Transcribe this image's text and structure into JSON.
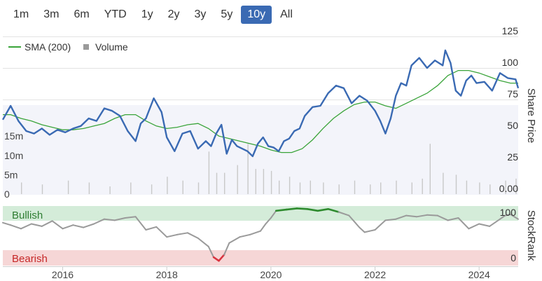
{
  "range_selector": {
    "buttons": [
      "1m",
      "3m",
      "6m",
      "YTD",
      "1y",
      "2y",
      "3y",
      "5y",
      "10y",
      "All"
    ],
    "active": "10y"
  },
  "colors": {
    "price": "#3a6ab3",
    "sma": "#3aa43a",
    "volume": "#c8c8c8",
    "bullish_band": "#d4ecd9",
    "bearish_band": "#f6d6d6",
    "stockrank_neutral": "#9a9a9a",
    "stockrank_bullish": "#2e8b2e",
    "stockrank_bearish": "#d9333f"
  },
  "chart_data": {
    "type": "line",
    "legend": [
      {
        "name": "SMA (200)",
        "marker": "line"
      },
      {
        "name": "Volume",
        "marker": "square"
      }
    ],
    "x_axis": {
      "ticks": [
        "2016",
        "2018",
        "2020",
        "2022",
        "2024"
      ],
      "xlim": [
        2014.85,
        2024.75
      ]
    },
    "price_axis": {
      "label": "Share Price",
      "ticks": [
        "125",
        "100",
        "75",
        "50",
        "25",
        "0.00"
      ],
      "ylim": [
        0,
        125
      ]
    },
    "volume_axis": {
      "ticks": [
        "15m",
        "10m",
        "5m",
        "0"
      ],
      "ylim": [
        0,
        23000000
      ]
    },
    "stockrank_axis": {
      "label": "StockRank",
      "ticks": [
        "100",
        "0"
      ],
      "ylim": [
        0,
        100
      ]
    },
    "bands": {
      "bullish": "Bullish",
      "bearish": "Bearish"
    },
    "price": {
      "x": [
        2014.85,
        2015.0,
        2015.15,
        2015.3,
        2015.45,
        2015.6,
        2015.75,
        2015.9,
        2016.05,
        2016.2,
        2016.35,
        2016.5,
        2016.65,
        2016.8,
        2016.95,
        2017.1,
        2017.25,
        2017.4,
        2017.5,
        2017.6,
        2017.75,
        2017.9,
        2018.0,
        2018.15,
        2018.3,
        2018.45,
        2018.6,
        2018.75,
        2018.85,
        2018.95,
        2019.05,
        2019.15,
        2019.25,
        2019.35,
        2019.45,
        2019.55,
        2019.65,
        2019.75,
        2019.85,
        2019.95,
        2020.05,
        2020.15,
        2020.25,
        2020.35,
        2020.45,
        2020.55,
        2020.65,
        2020.8,
        2020.95,
        2021.1,
        2021.25,
        2021.4,
        2021.55,
        2021.7,
        2021.85,
        2022.0,
        2022.1,
        2022.2,
        2022.3,
        2022.4,
        2022.5,
        2022.6,
        2022.7,
        2022.85,
        2023.0,
        2023.15,
        2023.3,
        2023.35,
        2023.45,
        2023.55,
        2023.65,
        2023.75,
        2023.85,
        2023.95,
        2024.1,
        2024.25,
        2024.4,
        2024.55,
        2024.7,
        2024.75
      ],
      "values": [
        59,
        70,
        58,
        50,
        48,
        52,
        47,
        51,
        49,
        52,
        54,
        60,
        58,
        68,
        66,
        62,
        50,
        42,
        56,
        60,
        76,
        65,
        45,
        34,
        48,
        50,
        36,
        42,
        38,
        48,
        55,
        32,
        43,
        38,
        36,
        34,
        30,
        40,
        45,
        38,
        37,
        34,
        42,
        44,
        50,
        52,
        62,
        69,
        70,
        80,
        86,
        84,
        72,
        78,
        74,
        66,
        58,
        48,
        60,
        78,
        88,
        86,
        102,
        108,
        100,
        106,
        102,
        114,
        104,
        82,
        78,
        90,
        94,
        88,
        89,
        82,
        96,
        92,
        91,
        84
      ]
    },
    "sma_200": {
      "x": [
        2014.85,
        2015.0,
        2015.2,
        2015.4,
        2015.6,
        2015.8,
        2016.0,
        2016.2,
        2016.4,
        2016.6,
        2016.8,
        2017.0,
        2017.2,
        2017.4,
        2017.6,
        2017.8,
        2018.0,
        2018.2,
        2018.4,
        2018.6,
        2018.8,
        2019.0,
        2019.2,
        2019.4,
        2019.6,
        2019.8,
        2020.0,
        2020.2,
        2020.4,
        2020.6,
        2020.8,
        2021.0,
        2021.2,
        2021.4,
        2021.6,
        2021.8,
        2022.0,
        2022.2,
        2022.4,
        2022.6,
        2022.8,
        2023.0,
        2023.2,
        2023.4,
        2023.6,
        2023.8,
        2024.0,
        2024.2,
        2024.4,
        2024.6,
        2024.75
      ],
      "values": [
        63,
        63,
        60,
        58,
        55,
        53,
        51,
        51,
        52,
        54,
        56,
        60,
        63,
        63,
        58,
        54,
        52,
        53,
        55,
        56,
        52,
        46,
        44,
        42,
        40,
        38,
        35,
        33,
        33,
        36,
        43,
        52,
        60,
        66,
        71,
        73,
        73,
        70,
        68,
        72,
        76,
        80,
        86,
        94,
        98,
        98,
        96,
        93,
        90,
        88,
        88
      ]
    },
    "volume": {
      "x": [
        2015.2,
        2015.6,
        2016.1,
        2016.5,
        2016.9,
        2017.3,
        2017.7,
        2018.0,
        2018.3,
        2018.6,
        2018.8,
        2018.95,
        2019.1,
        2019.35,
        2019.55,
        2019.7,
        2019.85,
        2020.0,
        2020.15,
        2020.35,
        2020.55,
        2020.75,
        2021.0,
        2021.3,
        2021.6,
        2021.9,
        2022.1,
        2022.4,
        2022.7,
        2022.9,
        2023.05,
        2023.3,
        2023.55,
        2023.75,
        2024.0,
        2024.2,
        2024.5,
        2024.7
      ],
      "values": [
        3000000,
        2500000,
        3500000,
        3000000,
        2000000,
        3000000,
        2500000,
        4500000,
        3500000,
        3000000,
        11000000,
        5500000,
        5500000,
        7500000,
        13000000,
        6500000,
        6500000,
        6000000,
        3500000,
        4500000,
        3000000,
        3500000,
        3000000,
        2500000,
        3500000,
        2500000,
        3000000,
        3500000,
        3000000,
        4000000,
        13000000,
        5500000,
        5000000,
        3500000,
        3000000,
        2500000,
        3500000,
        4000000
      ]
    },
    "stockrank": {
      "x": [
        2014.85,
        2015.0,
        2015.2,
        2015.4,
        2015.6,
        2015.8,
        2016.0,
        2016.2,
        2016.4,
        2016.6,
        2016.8,
        2017.0,
        2017.2,
        2017.4,
        2017.6,
        2017.8,
        2018.0,
        2018.2,
        2018.4,
        2018.6,
        2018.8,
        2018.9,
        2019.0,
        2019.1,
        2019.2,
        2019.4,
        2019.6,
        2019.8,
        2019.9,
        2020.0,
        2020.1,
        2020.3,
        2020.5,
        2020.7,
        2020.9,
        2021.1,
        2021.3,
        2021.5,
        2021.7,
        2021.8,
        2021.9,
        2022.0,
        2022.2,
        2022.4,
        2022.6,
        2022.8,
        2023.0,
        2023.2,
        2023.4,
        2023.6,
        2023.8,
        2024.0,
        2024.2,
        2024.4,
        2024.5,
        2024.6,
        2024.75
      ],
      "values": [
        72,
        68,
        62,
        70,
        66,
        75,
        62,
        68,
        64,
        70,
        78,
        76,
        80,
        82,
        60,
        65,
        48,
        52,
        55,
        46,
        32,
        14,
        8,
        18,
        38,
        48,
        52,
        58,
        70,
        80,
        92,
        94,
        96,
        95,
        92,
        95,
        90,
        84,
        64,
        56,
        58,
        60,
        76,
        78,
        84,
        82,
        85,
        84,
        76,
        80,
        62,
        70,
        66,
        78,
        84,
        86,
        78
      ]
    }
  }
}
